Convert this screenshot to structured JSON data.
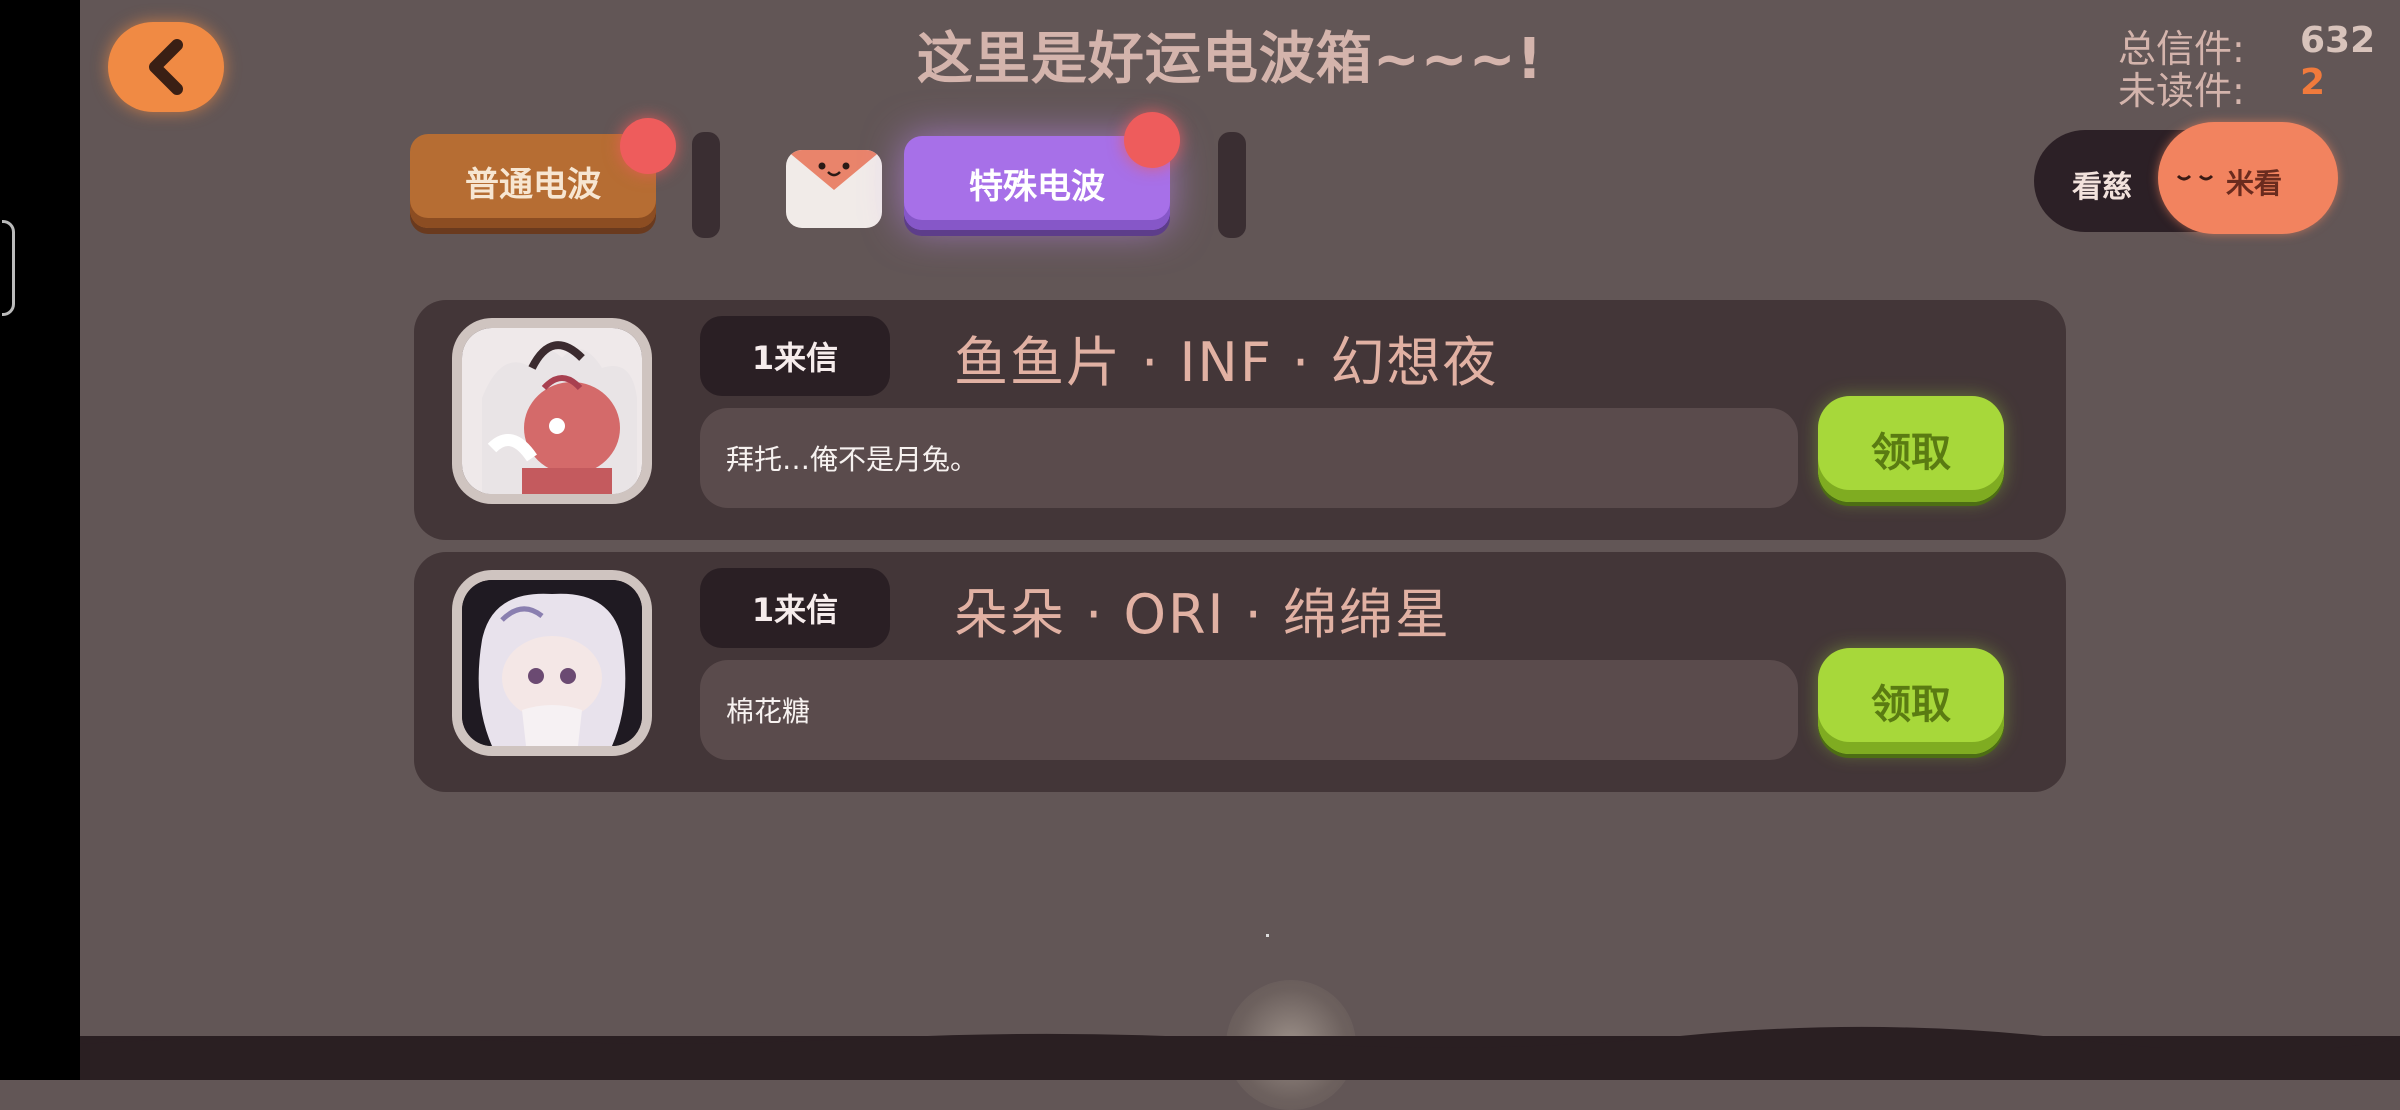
{
  "header": {
    "title": "这里是好运电波箱~~~!",
    "stats": {
      "total_label": "总信件:",
      "total_value": "632",
      "unread_label": "未读件:",
      "unread_value": "2"
    }
  },
  "tabs": [
    {
      "label": "普通电波",
      "active": false
    },
    {
      "label": "特殊电波",
      "active": true
    }
  ],
  "toggle": {
    "left_label": "看慈",
    "right_label": "米看"
  },
  "letters": [
    {
      "badge": "1来信",
      "sender": "鱼鱼片 · INF · 幻想夜",
      "message": "拜托…俺不是月兔。",
      "claim_label": "领取"
    },
    {
      "badge": "1来信",
      "sender": "朵朵 · ORI · 绵绵星",
      "message": "棉花糖",
      "claim_label": "领取"
    }
  ],
  "colors": {
    "background": "#625656",
    "accent_orange": "#f08a44",
    "tab_normal": "#b66d33",
    "tab_special": "#a770e8",
    "claim_green": "#a7d83a",
    "notification_red": "#ee5c5c"
  }
}
